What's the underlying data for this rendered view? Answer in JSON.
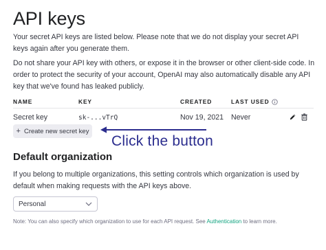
{
  "page": {
    "title": "API keys",
    "intro": "Your secret API keys are listed below. Please note that we do not display your secret API keys again after you generate them.",
    "warning": "Do not share your API key with others, or expose it in the browser or other client-side code. In order to protect the security of your account, OpenAI may also automatically disable any API key that we've found has leaked publicly."
  },
  "table": {
    "headers": [
      "NAME",
      "KEY",
      "CREATED",
      "LAST USED"
    ],
    "rows": [
      {
        "name": "Secret key",
        "key": "sk-...vTrQ",
        "created": "Nov 19, 2021",
        "last_used": "Never"
      }
    ],
    "icons": {
      "info": "info-icon",
      "edit": "pencil-icon",
      "delete": "trash-icon"
    }
  },
  "create_button": {
    "label": "Create new secret key",
    "icon": "plus-icon"
  },
  "annotation": {
    "text": "Click the button",
    "color": "#2b2d8e"
  },
  "default_org": {
    "title": "Default organization",
    "description": "If you belong to multiple organizations, this setting controls which organization is used by default when making requests with the API keys above.",
    "select_value": "Personal",
    "note_prefix": "Note: You can also specify which organization to use for each API request. See ",
    "note_link": "Authentication",
    "note_suffix": " to learn more."
  },
  "colors": {
    "accent_link": "#10a37f",
    "button_bg": "#ececf1"
  }
}
